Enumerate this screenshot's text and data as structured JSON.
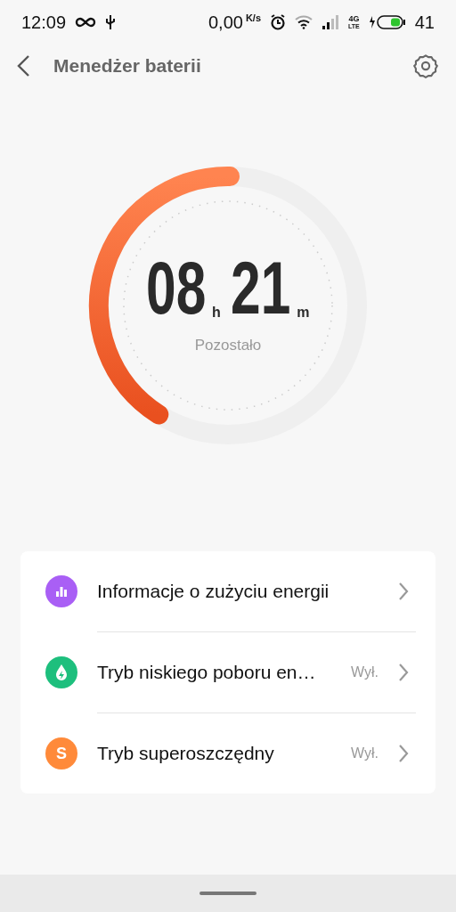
{
  "status_bar": {
    "time": "12:09",
    "speed": "0,00",
    "speed_unit": "K/s",
    "network": "4G",
    "network_sub": "LTE",
    "battery": "41"
  },
  "header": {
    "title": "Menedżer baterii"
  },
  "gauge": {
    "hours": "08",
    "hours_unit": "h",
    "minutes": "21",
    "minutes_unit": "m",
    "caption": "Pozostało"
  },
  "items": [
    {
      "label": "Informacje o zużyciu energii",
      "kind": "chart",
      "color": "#a95ff5"
    },
    {
      "label": "Tryb niskiego poboru en…",
      "kind": "drop",
      "color": "#1dbf7d",
      "value": "Wył."
    },
    {
      "label": "Tryb superoszczędny",
      "kind": "letter",
      "letter": "S",
      "color": "#ff8a3a",
      "value": "Wył."
    }
  ]
}
